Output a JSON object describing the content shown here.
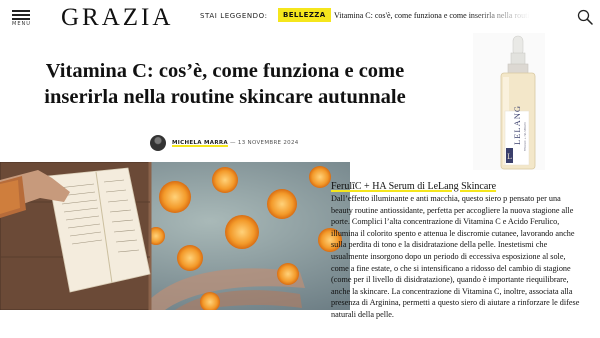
{
  "header": {
    "menu_label": "MENU",
    "logo": "GRAZIA",
    "reading_label": "STAI LEGGENDO:",
    "category_badge": "BELLEZZA",
    "reading_title": "Vitamina C: cos'è, come funziona e come inserirla nella routine skincare autunnale"
  },
  "article": {
    "title": "Vitamina C: cos’è, come funziona e come inserirla nella routine skincare autunnale",
    "author": "MICHELA MARRA",
    "date_separator": "—",
    "date": "13 NOVEMBRE 2024"
  },
  "product_image": {
    "brand": "LELANG",
    "subtitle": "FERULIC + HA SERUM"
  },
  "product_card": {
    "title": "FerulīC + HA Serum di LeLang Skincare",
    "body": "Dall’effetto illuminante e anti macchia, questo siero p pensato per una beauty routine antiossidante, perfetta per accogliere la nuova stagione alle porte. Complici l’alta concentrazione di Vitamina C e Acido Ferulico, illumina il colorito spento e attenua le discromie cutanee, lavorando anche sulla perdita di tono e la disidratazione della pelle. Inestetismi che usualmente insorgono dopo un periodo di eccessiva esposizione al sole, come a fine estate, o che si intensificano a ridosso del cambio di stagione (come per il livello di disidratazione), quando è importante riequilibrare, anche la skincare. La concentrazione di Vitamina C, inoltre, associata alla presenza di Arginina, permetti a questo siero di aiutare a rinforzare le difese naturali della pelle."
  },
  "colors": {
    "accent_yellow": "#f5e61c",
    "text": "#111111"
  },
  "icons": [
    "hamburger-menu-icon",
    "search-icon"
  ]
}
